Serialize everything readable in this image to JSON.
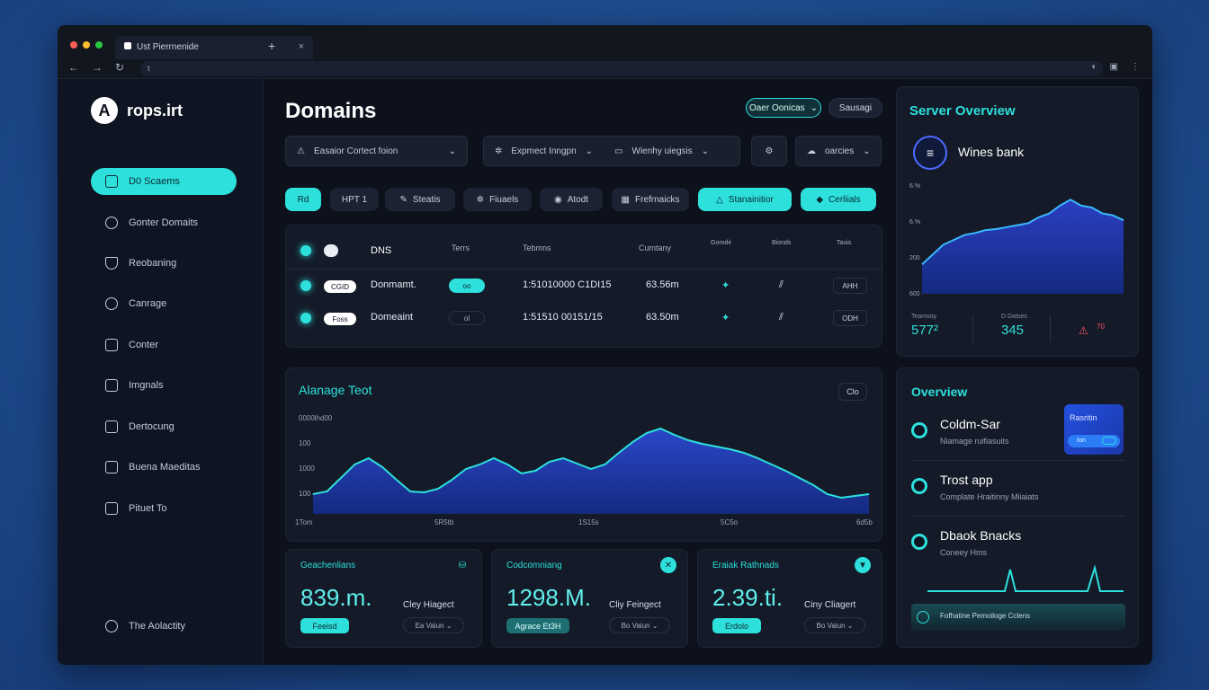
{
  "browser": {
    "tab_title": "Ust Pierrnenide",
    "close": "×",
    "new_tab": "+",
    "url": "t"
  },
  "sidebar": {
    "logo_text": "rops.irt",
    "items": [
      {
        "label": "D0 Scaems",
        "icon": "dns-icon",
        "active": true
      },
      {
        "label": "Gonter Domaits",
        "icon": "sparkle-icon"
      },
      {
        "label": "Reobaning",
        "icon": "shield-icon"
      },
      {
        "label": "Canrage",
        "icon": "user-icon"
      },
      {
        "label": "Conter",
        "icon": "window-icon"
      },
      {
        "label": "Imgnals",
        "icon": "server-icon"
      },
      {
        "label": "Dertocung",
        "icon": "chart-icon"
      },
      {
        "label": "Buena Maeditas",
        "icon": "mail-icon"
      },
      {
        "label": "Pituet To",
        "icon": "list-icon"
      }
    ],
    "footer": "The Aolactity"
  },
  "main": {
    "title": "Domains",
    "top_buttons": [
      "Oaer Oonicas",
      "Sausagi"
    ],
    "dropdowns": [
      "Easaior Cortect foion",
      "Expmect Inngpn",
      "Wienhy uiegsis",
      "oarcies"
    ],
    "chips": [
      "Rd",
      "HPT 1",
      "Steatis",
      "Fiuaels",
      "Atodt",
      "Frefrnaicks",
      "Stanainitior",
      "Cerliials"
    ],
    "table": {
      "headers": [
        "DNS",
        "Terrs",
        "Tebmns",
        "Cumtany",
        "Gorodir",
        "Bionds",
        "Tauis"
      ],
      "rows": [
        {
          "tag": "CGID",
          "name": "Donmamt.",
          "status": "oo",
          "date": "1:51010000 C1DI15",
          "value": "63.56m",
          "act": "AHH"
        },
        {
          "tag": "Foss",
          "name": "Domeaint",
          "status": "ol",
          "date": "1:51510 00151/15",
          "value": "63.50m",
          "act": "ODH"
        }
      ]
    }
  },
  "chart_panel": {
    "title": "Alanage Teot",
    "button": "Clo"
  },
  "chart_data": {
    "type": "area",
    "title": "Alanage Teot",
    "ytick_labels": [
      "0000lhd00",
      "100",
      "1000",
      "100"
    ],
    "xtick_labels": [
      "1Tom",
      "5R5tb",
      "1S15s",
      "5C5o",
      "6d5b"
    ],
    "x": [
      0,
      1,
      2,
      3,
      4,
      5,
      6,
      7,
      8,
      9,
      10,
      11,
      12,
      13,
      14,
      15,
      16,
      17,
      18,
      19,
      20,
      21,
      22,
      23,
      24,
      25,
      26,
      27,
      28,
      29,
      30,
      31,
      32,
      33,
      34,
      35,
      36,
      37,
      38,
      39,
      40
    ],
    "values": [
      22,
      25,
      40,
      55,
      62,
      52,
      38,
      25,
      24,
      28,
      38,
      50,
      55,
      62,
      55,
      45,
      48,
      58,
      62,
      56,
      50,
      55,
      68,
      80,
      90,
      95,
      88,
      82,
      78,
      75,
      72,
      68,
      62,
      55,
      48,
      40,
      32,
      22,
      18,
      20,
      22
    ],
    "ylim": [
      0,
      110
    ],
    "grid": false
  },
  "stats": [
    {
      "title": "Geachenlians",
      "value": "839.m.",
      "sub": "Cley Hiagect",
      "button": "Feeisd",
      "select": "Ea Vaiun ⌄",
      "icon": "drive-icon"
    },
    {
      "title": "Codcomniang",
      "value": "1298.M.",
      "sub": "Cliy Feingect",
      "button": "Agrace Et3H",
      "select": "Bo Vaiun ⌄",
      "icon": "wrench-icon"
    },
    {
      "title": "Eraiak Rathnads",
      "value": "2.39.ti.",
      "sub": "Ciny Cliagert",
      "button": "Erdolo",
      "select": "Bo Vaiun ⌄",
      "icon": "shield-icon"
    }
  ],
  "server_overview": {
    "title": "Server Overview",
    "subtitle": "Wines bank",
    "ytick_labels": [
      "6.%",
      "6.%",
      "200",
      "600"
    ],
    "stats": [
      {
        "label": "Teamsoy",
        "value": "577²"
      },
      {
        "label": "D Datses",
        "value": "345"
      },
      {
        "label": "",
        "value": "70"
      }
    ]
  },
  "server_chart_data": {
    "type": "area",
    "values": [
      30,
      40,
      50,
      55,
      60,
      62,
      65,
      66,
      68,
      70,
      72,
      78,
      82,
      90,
      96,
      90,
      88,
      82,
      80,
      75
    ],
    "ylim": [
      0,
      110
    ]
  },
  "overview": {
    "title": "Overview",
    "items": [
      {
        "title": "Coldm-Sar",
        "sub": "Niamage ruifiasuits"
      },
      {
        "title": "Trost app",
        "sub": "Complate Hraitinny Miiaiats"
      },
      {
        "title": "Dbaok Bnacks",
        "sub": "Coneey Hms"
      }
    ],
    "card": {
      "title": "Rasritin",
      "toggle": "Ion"
    },
    "footer": "Fofhatine Pemoiloge Cclens"
  }
}
